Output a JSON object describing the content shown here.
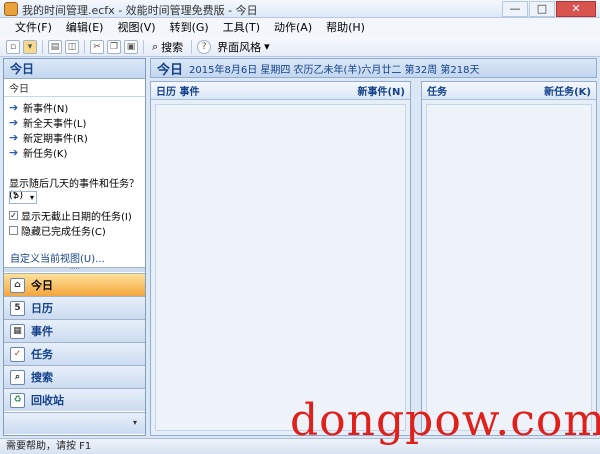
{
  "window": {
    "title": "我的时间管理.ecfx - 效能时间管理免费版 - 今日",
    "buttons": [
      "—",
      "□",
      "✕"
    ]
  },
  "menu": [
    "文件(F)",
    "编辑(E)",
    "视图(V)",
    "转到(G)",
    "工具(T)",
    "动作(A)",
    "帮助(H)"
  ],
  "toolbar": {
    "search_label": "搜索",
    "style_label": "界面风格"
  },
  "left_pane": {
    "header": "今日",
    "sub": "今日",
    "links": [
      "新事件(N)",
      "新全天事件(L)",
      "新定期事件(R)",
      "新任务(K)"
    ],
    "question": "显示随后几天的事件和任务？(S)",
    "select_value": "?",
    "check_overdue": "显示无截止日期的任务(I)",
    "check_hide_done": "隐藏已完成任务(C)",
    "custom_view": "自定义当前视图(U)..."
  },
  "nav": {
    "today": "今日",
    "calendar": "日历",
    "events": "事件",
    "tasks": "任务",
    "search": "搜索",
    "recycle": "回收站"
  },
  "main": {
    "title": "今日",
    "date": "2015年8月6日 星期四 农历乙未年(羊)六月廿二 第32周 第218天",
    "events_panel": {
      "title": "日历 事件",
      "new": "新事件(N)"
    },
    "tasks_panel": {
      "title": "任务",
      "new": "新任务(K)"
    }
  },
  "status": "需要帮助，请按 F1",
  "watermark": "dongpow.com"
}
